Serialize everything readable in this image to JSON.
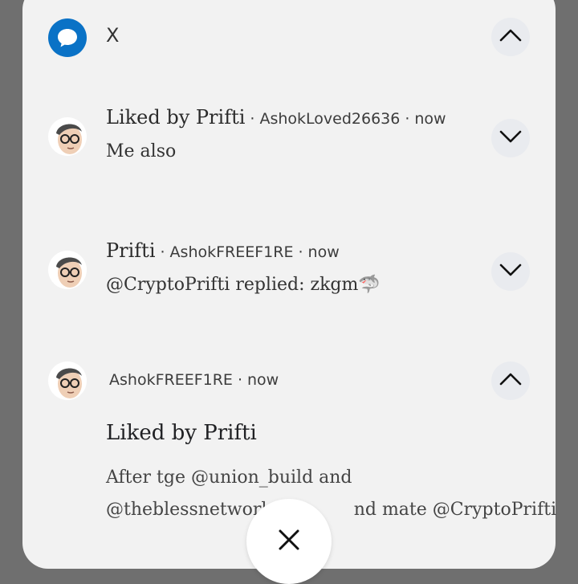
{
  "group": {
    "app_name": "X",
    "app_icon": "speech-bubble-icon",
    "accent": "#0a72c6"
  },
  "notifications": [
    {
      "title": "Liked by Prifti",
      "account": "AshokLoved26636",
      "time": "now",
      "text": "Me also",
      "toggle": "chevron-down-icon"
    },
    {
      "title": "Prifti",
      "account": "AshokFREEF1RE",
      "time": "now",
      "text": "@CryptoPrifti replied: zkgm",
      "emoji": "🦈",
      "toggle": "chevron-down-icon"
    },
    {
      "account": "AshokFREEF1RE",
      "time": "now",
      "title": "Liked by Prifti",
      "body_line1": "After  tge @union_build and",
      "body_line2": "@theblessnetwork",
      "body_line3_end": "nd mate @CryptoPrifti",
      "toggle": "chevron-up-icon"
    }
  ],
  "separator": "·",
  "close": {
    "icon": "close-icon"
  }
}
